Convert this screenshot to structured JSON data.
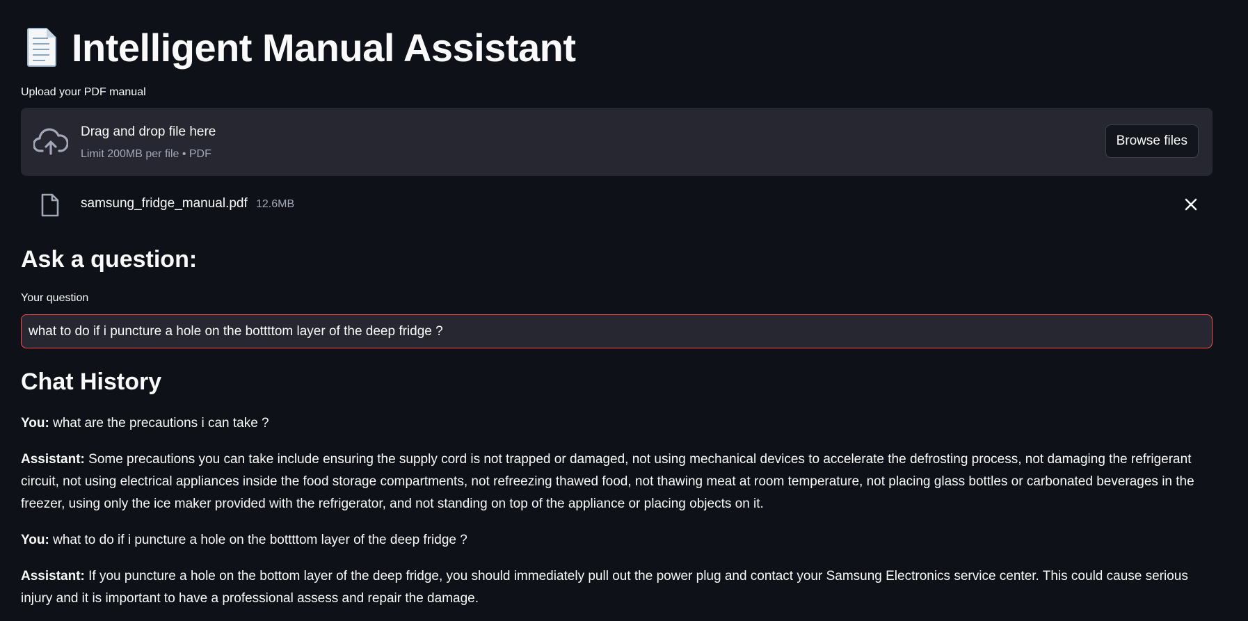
{
  "app": {
    "title": "Intelligent Manual Assistant",
    "title_icon": "page-facing-up-icon"
  },
  "uploader": {
    "label": "Upload your PDF manual",
    "drop_text": "Drag and drop file here",
    "limit_text": "Limit 200MB per file • PDF",
    "browse_label": "Browse files",
    "file": {
      "name": "samsung_fridge_manual.pdf",
      "size": "12.6MB"
    }
  },
  "ask": {
    "heading": "Ask a question:",
    "label": "Your question",
    "value": "what to do if i puncture a hole on the bottttom layer of the deep fridge ?"
  },
  "history": {
    "heading": "Chat History",
    "messages": [
      {
        "speaker": "You:",
        "text": "what are the precautions i can take ?"
      },
      {
        "speaker": "Assistant:",
        "text": "Some precautions you can take include ensuring the supply cord is not trapped or damaged, not using mechanical devices to accelerate the defrosting process, not damaging the refrigerant circuit, not using electrical appliances inside the food storage compartments, not refreezing thawed food, not thawing meat at room temperature, not placing glass bottles or carbonated beverages in the freezer, using only the ice maker provided with the refrigerator, and not standing on top of the appliance or placing objects on it."
      },
      {
        "speaker": "You:",
        "text": "what to do if i puncture a hole on the bottttom layer of the deep fridge ?"
      },
      {
        "speaker": "Assistant:",
        "text": "If you puncture a hole on the bottom layer of the deep fridge, you should immediately pull out the power plug and contact your Samsung Electronics service center. This could cause serious injury and it is important to have a professional assess and repair the damage."
      }
    ]
  },
  "colors": {
    "background": "#0e1117",
    "surface": "#262730",
    "text": "#fafafa",
    "muted": "#a3a8b8",
    "focus_border": "#ff4b4b"
  }
}
